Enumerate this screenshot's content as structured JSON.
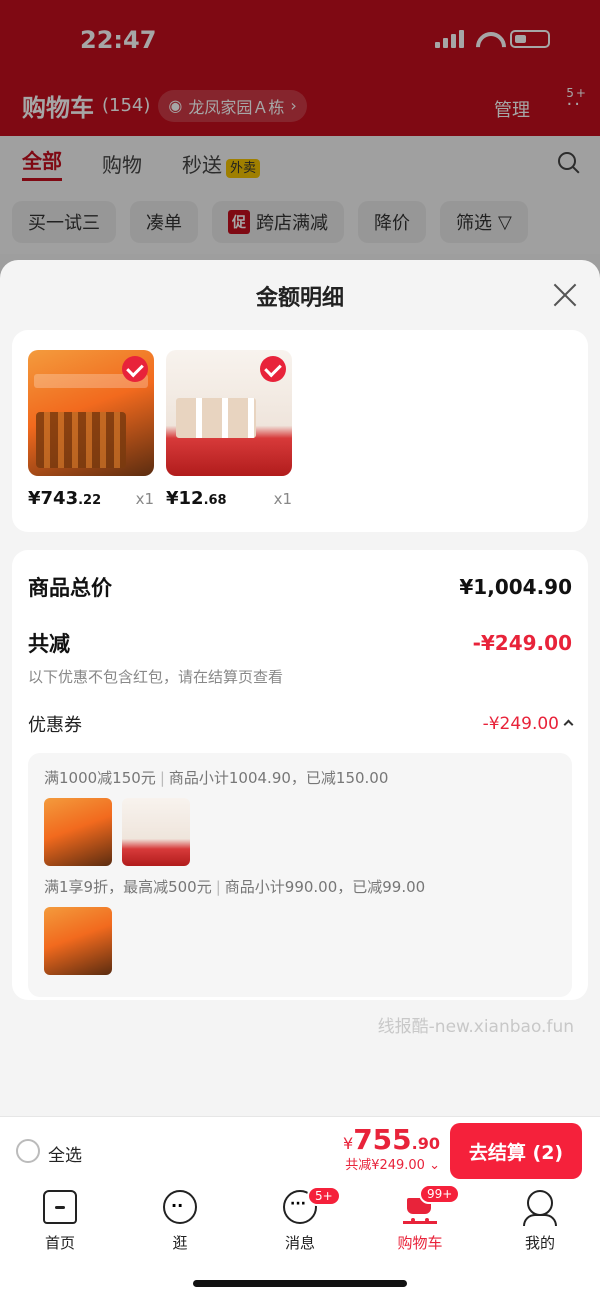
{
  "status_bar": {
    "time": "22:47"
  },
  "header": {
    "title": "购物车",
    "count": "(154)",
    "address": "龙凤家园Ａ栋",
    "manage": "管理",
    "more_badge": "5+"
  },
  "tabs": [
    {
      "label": "全部"
    },
    {
      "label": "购物"
    },
    {
      "label": "秒送",
      "tag": "外卖"
    }
  ],
  "chips": [
    {
      "label": "买一试三"
    },
    {
      "label": "凑单"
    },
    {
      "label": "跨店满减",
      "tag": "促"
    },
    {
      "label": "降价"
    },
    {
      "label": "筛选"
    }
  ],
  "sheet": {
    "title": "金额明细",
    "products": [
      {
        "price_int": "¥743",
        "price_dec": ".22",
        "qty": "x1"
      },
      {
        "price_int": "¥12",
        "price_dec": ".68",
        "qty": "x1"
      }
    ],
    "total_label": "商品总价",
    "total_value": "¥1,004.90",
    "discount_label": "共减",
    "discount_value": "-¥249.00",
    "discount_note": "以下优惠不包含红包，请在结算页查看",
    "coupon_label": "优惠券",
    "coupon_value": "-¥249.00",
    "coupon_rules": [
      {
        "rule": "满1000减150元",
        "detail": "商品小计1004.90，已减150.00"
      },
      {
        "rule": "满1享9折，最高减500元",
        "detail": "商品小计990.00，已减99.00"
      }
    ],
    "watermark": "线报酷-new.xianbao.fun"
  },
  "checkout": {
    "select_all": "全选",
    "currency": "¥",
    "amount_int": "755",
    "amount_dec": ".90",
    "saved": "共减¥249.00",
    "pay_button": "去结算 (2)"
  },
  "tabbar": [
    {
      "label": "首页",
      "icon": "home-icon"
    },
    {
      "label": "逛",
      "icon": "browse-icon"
    },
    {
      "label": "消息",
      "icon": "message-icon",
      "badge": "5+"
    },
    {
      "label": "购物车",
      "icon": "cart-icon",
      "badge": "99+"
    },
    {
      "label": "我的",
      "icon": "profile-icon"
    }
  ],
  "colors": {
    "brand_red": "#e8233a",
    "header_red": "#c40f1e"
  }
}
